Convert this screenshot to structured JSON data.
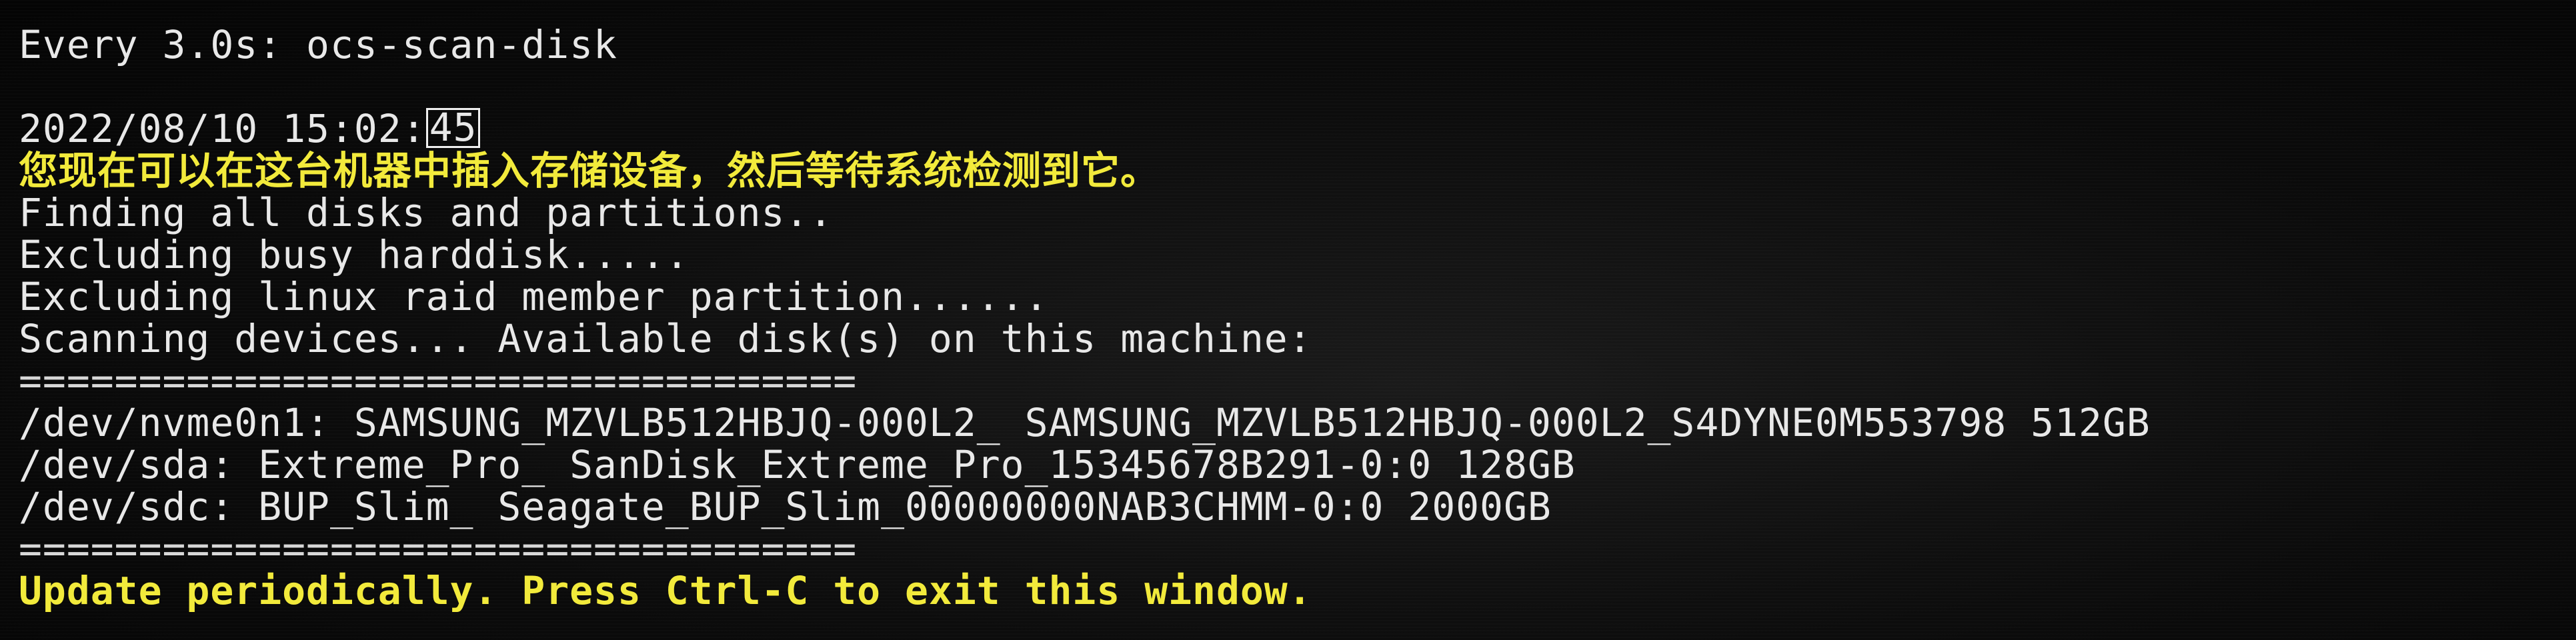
{
  "watch_header": "Every 3.0s: ocs-scan-disk",
  "timestamp": {
    "prefix": "2022/08/10 15:02:",
    "seconds": "45"
  },
  "instruction_cn": "您现在可以在这台机器中插入存储设备，然后等待系统检测到它。",
  "status_lines": [
    "Finding all disks and partitions..",
    "Excluding busy harddisk.....",
    "Excluding linux raid member partition......",
    "Scanning devices... Available disk(s) on this machine:"
  ],
  "separator": "===================================",
  "disks": [
    "/dev/nvme0n1: SAMSUNG_MZVLB512HBJQ-000L2_ SAMSUNG_MZVLB512HBJQ-000L2_S4DYNE0M553798 512GB",
    "/dev/sda: Extreme_Pro_ SanDisk_Extreme_Pro_15345678B291-0:0 128GB",
    "/dev/sdc: BUP_Slim_ Seagate_BUP_Slim_00000000NAB3CHMM-0:0 2000GB"
  ],
  "footer": "Update periodically. Press Ctrl-C to exit this window.",
  "colors": {
    "text": "#e8e8e8",
    "highlight": "#f2ea3a",
    "background": "#050505"
  }
}
